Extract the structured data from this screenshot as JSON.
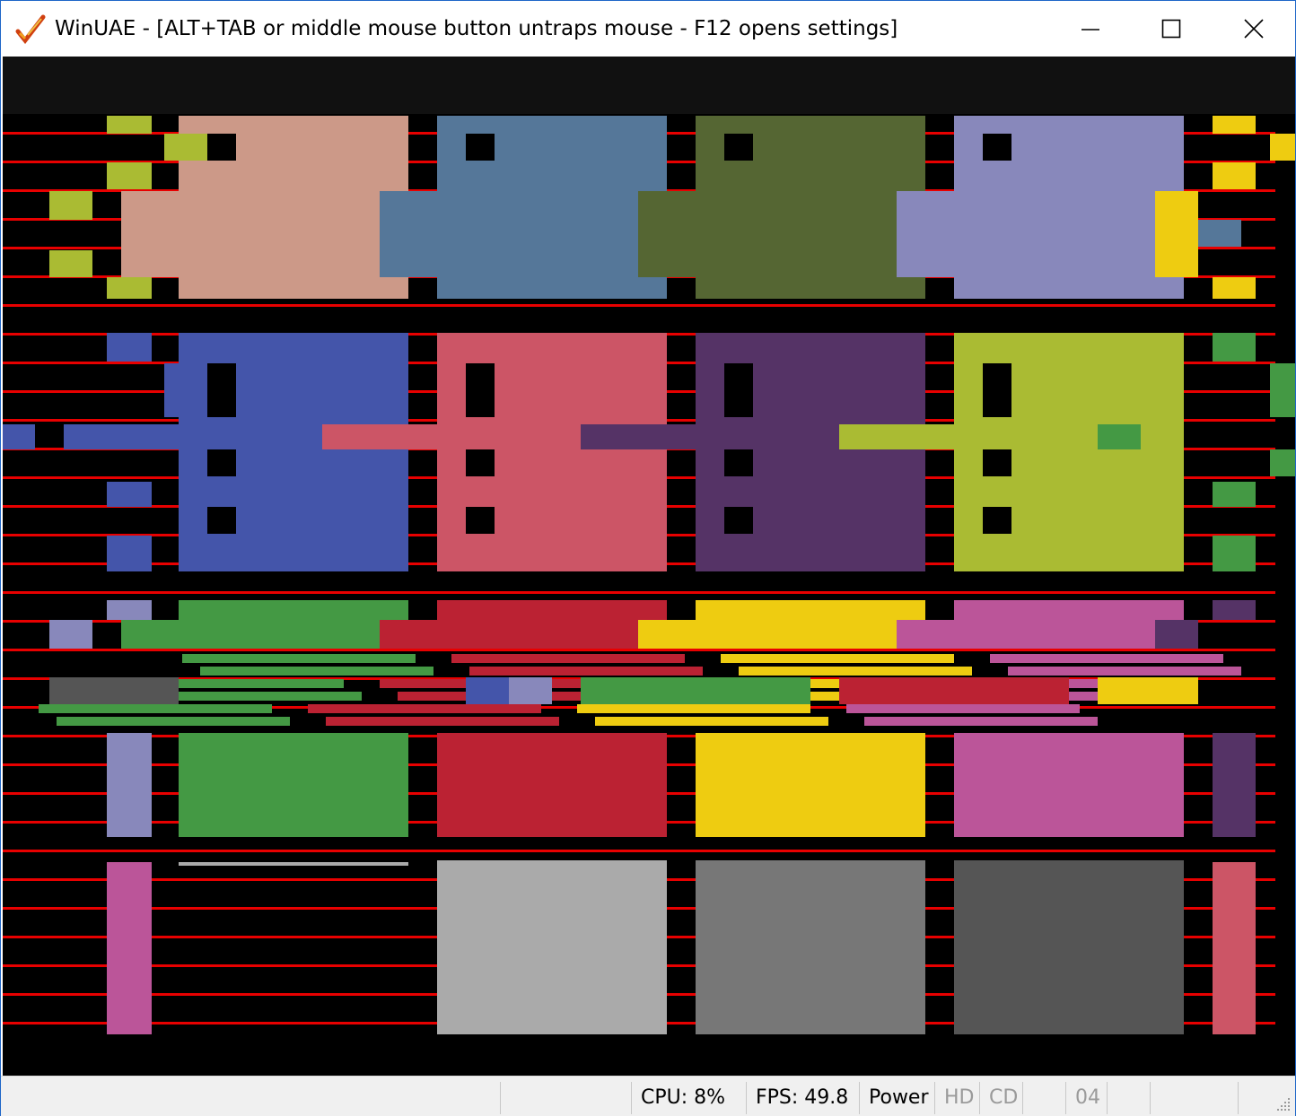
{
  "window": {
    "title": "WinUAE - [ALT+TAB or middle mouse button untraps mouse - F12 opens settings]",
    "icon": "winuae-checkmark-icon",
    "controls": [
      "minimize",
      "maximize",
      "close"
    ]
  },
  "statusbar": {
    "cells": [
      {
        "id": "cpu",
        "text": "CPU: 8%"
      },
      {
        "id": "fps",
        "text": "FPS: 49.8"
      },
      {
        "id": "power",
        "text": "Power"
      },
      {
        "id": "hd",
        "text": "HD"
      },
      {
        "id": "cd",
        "text": "CD"
      },
      {
        "id": "blank1",
        "text": ""
      },
      {
        "id": "drive",
        "text": "04"
      },
      {
        "id": "blank2",
        "text": ""
      },
      {
        "id": "blank3",
        "text": ""
      }
    ]
  },
  "colors": {
    "background": "#111111",
    "scanline": "#e80000",
    "palette": {
      "salmon": "#cc9988",
      "steel": "#557799",
      "olive": "#556633",
      "lavender": "#8888bb",
      "blue": "#4455aa",
      "rose": "#cc5566",
      "purple": "#553366",
      "lime": "#aabb33",
      "green": "#449944",
      "red": "#bb2233",
      "yellow": "#eecc11",
      "magenta": "#bb5599",
      "lightgray": "#aaaaaa",
      "midgray": "#777777",
      "darkgray": "#555555",
      "gold": "#eecc11"
    }
  }
}
